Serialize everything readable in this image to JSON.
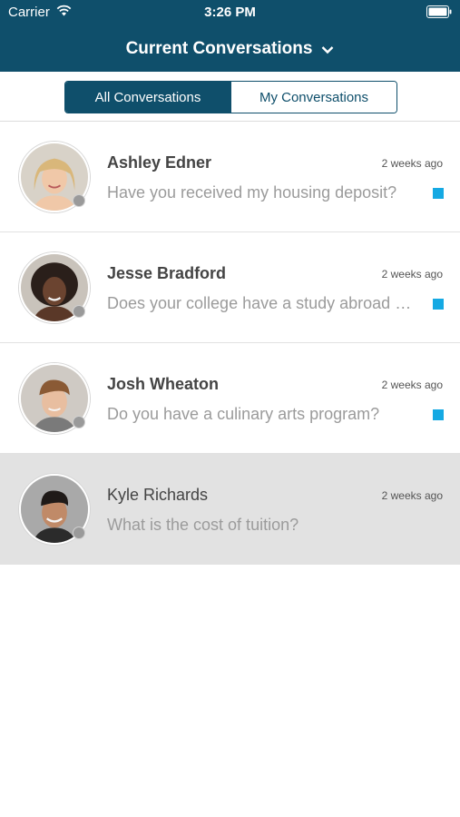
{
  "status_bar": {
    "carrier": "Carrier",
    "time": "3:26 PM",
    "icons": [
      "wifi-icon",
      "battery-icon"
    ]
  },
  "header": {
    "title": "Current Conversations",
    "dropdown_icon": "chevron-down-icon",
    "background": "#0f4f6b"
  },
  "tabs": [
    {
      "label": "All Conversations",
      "selected": true
    },
    {
      "label": "My Conversations",
      "selected": false
    }
  ],
  "colors": {
    "primary": "#0f4f6b",
    "unread_indicator": "#15a9e3",
    "selected_row": "#e2e2e2",
    "presence_offline": "#9a9a9a"
  },
  "conversations": [
    {
      "name": "Ashley Edner",
      "time": "2 weeks ago",
      "preview": "Have you received my housing deposit?",
      "unread": true,
      "selected": false
    },
    {
      "name": "Jesse Bradford",
      "time": "2 weeks ago",
      "preview": "Does your college have a study abroad pro…",
      "unread": true,
      "selected": false
    },
    {
      "name": "Josh Wheaton",
      "time": "2 weeks ago",
      "preview": "Do you have a culinary arts program?",
      "unread": true,
      "selected": false
    },
    {
      "name": "Kyle Richards",
      "time": "2 weeks ago",
      "preview": "What is the cost of tuition?",
      "unread": false,
      "selected": true
    }
  ]
}
